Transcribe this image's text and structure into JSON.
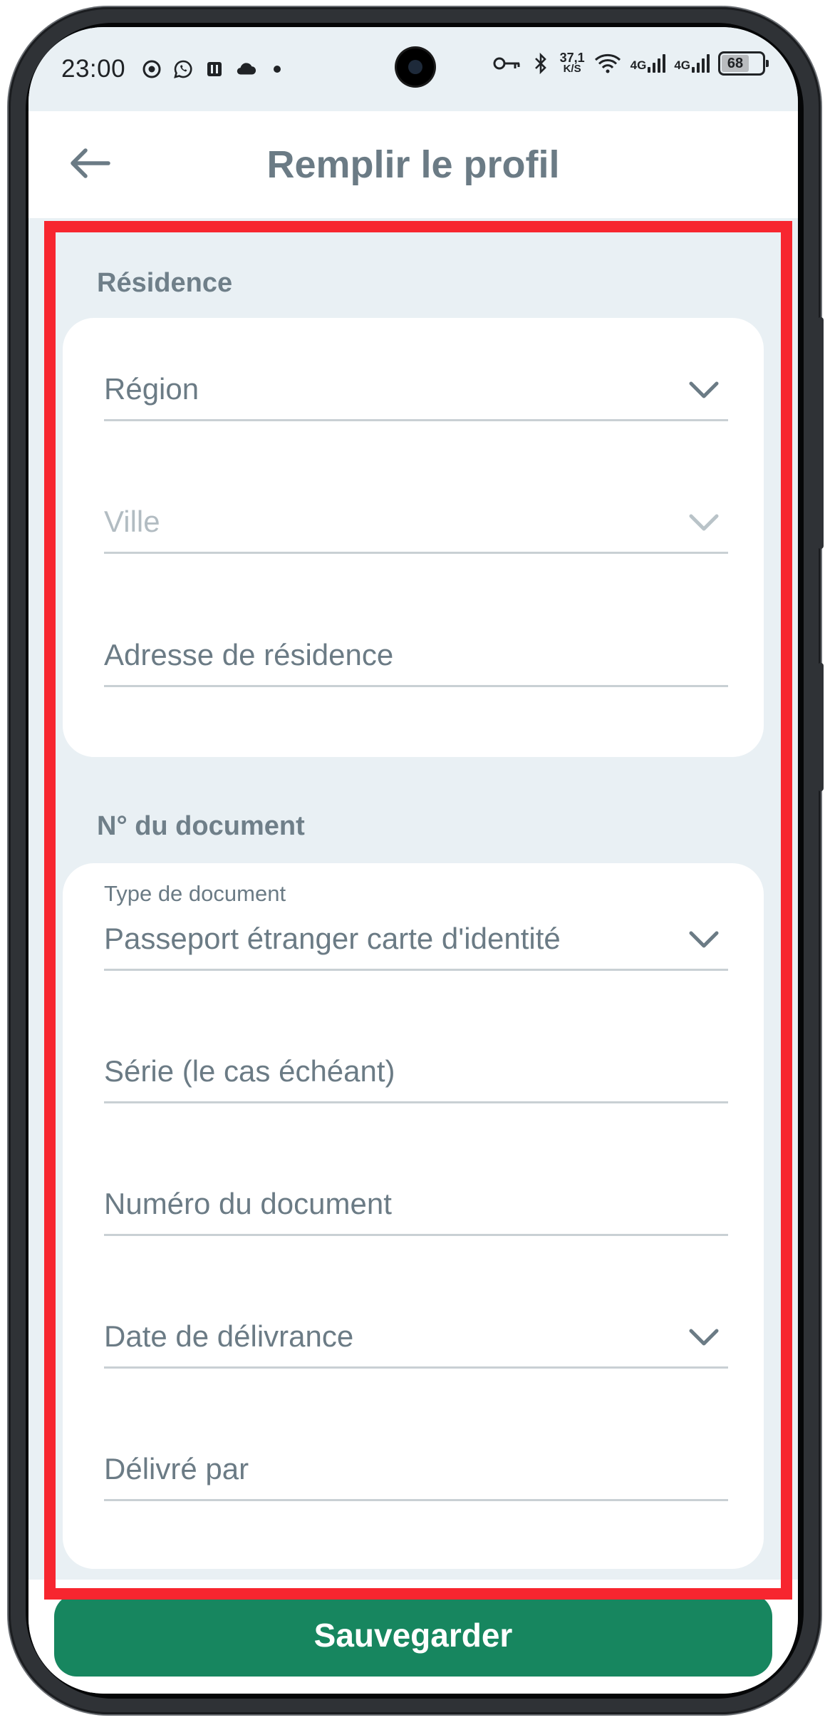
{
  "status_bar": {
    "time": "23:00",
    "left_icons": [
      "chrome-icon",
      "whatsapp-icon",
      "sim-icon",
      "cloud-icon",
      "dot-icon"
    ],
    "net_speed_value": "37,1",
    "net_speed_unit": "K/S",
    "network_1": "4G",
    "network_2": "4G",
    "battery": "68"
  },
  "header": {
    "title": "Remplir le profil",
    "back_icon": "arrow-left-icon"
  },
  "residence": {
    "section_title": "Résidence",
    "region_placeholder": "Région",
    "city_placeholder": "Ville",
    "address_placeholder": "Adresse de résidence"
  },
  "document": {
    "section_title": "N° du document",
    "type_label": "Type de document",
    "type_value": "Passeport étranger carte d'identité",
    "series_placeholder": "Série (le cas échéant)",
    "number_placeholder": "Numéro du document",
    "issue_date_placeholder": "Date de délivrance",
    "issued_by_placeholder": "Délivré par"
  },
  "footer": {
    "save_label": "Sauvegarder"
  },
  "colors": {
    "accent": "#17865f",
    "highlight": "#f7262f",
    "background": "#e9f0f4",
    "text": "#6b7b85"
  }
}
